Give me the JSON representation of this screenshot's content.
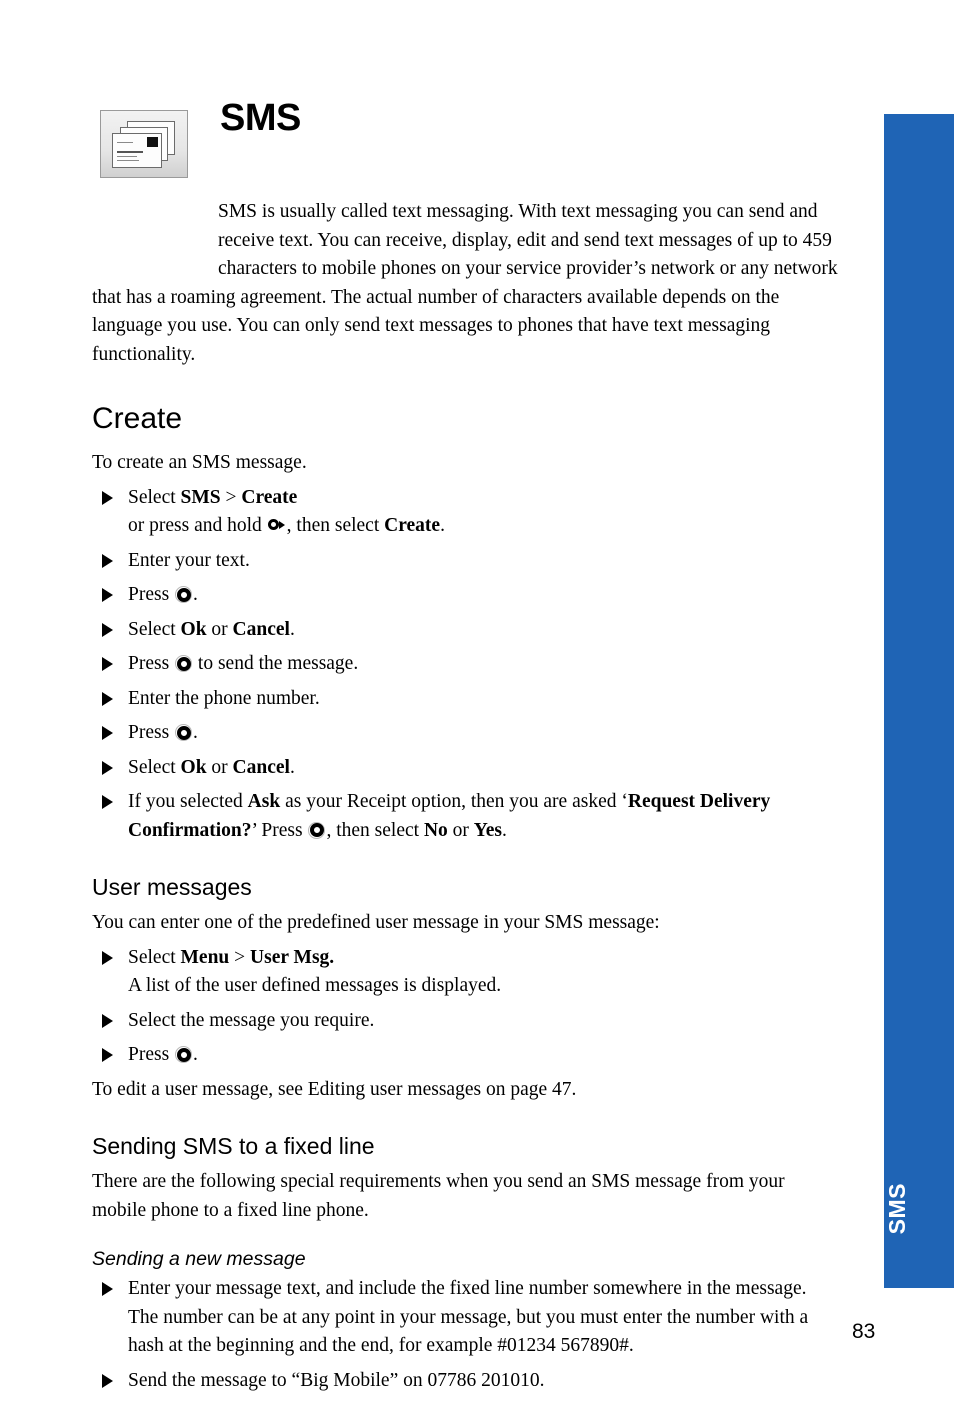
{
  "document": {
    "page_number": "83",
    "side_tab_label": "SMS",
    "side_tab_color": "#1f64b5",
    "icon_name": "sms-messages-icon"
  },
  "header": {
    "title": "SMS",
    "intro": "SMS is usually called text messaging. With text messaging you can send and receive text. You can receive, display, edit and send text messages of up to 459 characters to mobile phones on your service provider’s network or any network that has a roaming agreement. The actual number of characters available depends on the language you use. You can only send text messages to phones that have text messaging functionality."
  },
  "sections": {
    "create": {
      "heading": "Create",
      "intro": "To create an SMS message.",
      "steps": [
        {
          "parts": [
            {
              "t": "text",
              "v": "Select "
            },
            {
              "t": "bold",
              "v": "SMS"
            },
            {
              "t": "text",
              "v": " > "
            },
            {
              "t": "bold",
              "v": "Create"
            }
          ],
          "sub_parts": [
            {
              "t": "text",
              "v": "or press and hold "
            },
            {
              "t": "key",
              "v": "right-key-icon"
            },
            {
              "t": "text",
              "v": ", then select "
            },
            {
              "t": "bold",
              "v": "Create"
            },
            {
              "t": "text",
              "v": "."
            }
          ]
        },
        {
          "parts": [
            {
              "t": "text",
              "v": "Enter your text."
            }
          ]
        },
        {
          "parts": [
            {
              "t": "text",
              "v": "Press "
            },
            {
              "t": "key",
              "v": "select-key-icon"
            },
            {
              "t": "text",
              "v": "."
            }
          ]
        },
        {
          "parts": [
            {
              "t": "text",
              "v": "Select "
            },
            {
              "t": "bold",
              "v": "Ok"
            },
            {
              "t": "text",
              "v": " or "
            },
            {
              "t": "bold",
              "v": "Cancel"
            },
            {
              "t": "text",
              "v": "."
            }
          ]
        },
        {
          "parts": [
            {
              "t": "text",
              "v": "Press "
            },
            {
              "t": "key",
              "v": "select-key-icon"
            },
            {
              "t": "text",
              "v": " to send the message."
            }
          ]
        },
        {
          "parts": [
            {
              "t": "text",
              "v": "Enter the phone number."
            }
          ]
        },
        {
          "parts": [
            {
              "t": "text",
              "v": "Press "
            },
            {
              "t": "key",
              "v": "select-key-icon"
            },
            {
              "t": "text",
              "v": "."
            }
          ]
        },
        {
          "parts": [
            {
              "t": "text",
              "v": "Select "
            },
            {
              "t": "bold",
              "v": "Ok"
            },
            {
              "t": "text",
              "v": " or "
            },
            {
              "t": "bold",
              "v": "Cancel"
            },
            {
              "t": "text",
              "v": "."
            }
          ]
        },
        {
          "parts": [
            {
              "t": "text",
              "v": "If you selected "
            },
            {
              "t": "bold",
              "v": "Ask"
            },
            {
              "t": "text",
              "v": " as your Receipt option, then you are asked ‘"
            },
            {
              "t": "bold",
              "v": "Request Delivery Confirmation?"
            },
            {
              "t": "text",
              "v": "’ Press "
            },
            {
              "t": "key",
              "v": "select-key-icon"
            },
            {
              "t": "text",
              "v": ", then select "
            },
            {
              "t": "bold",
              "v": "No"
            },
            {
              "t": "text",
              "v": " or "
            },
            {
              "t": "bold",
              "v": "Yes"
            },
            {
              "t": "text",
              "v": "."
            }
          ]
        }
      ]
    },
    "user_messages": {
      "heading": "User messages",
      "intro": "You can enter one of the predefined user message in your SMS message:",
      "steps": [
        {
          "parts": [
            {
              "t": "text",
              "v": "Select "
            },
            {
              "t": "bold",
              "v": "Menu"
            },
            {
              "t": "text",
              "v": " > "
            },
            {
              "t": "bold",
              "v": "User Msg."
            }
          ],
          "sub_parts": [
            {
              "t": "text",
              "v": "A list of the user defined messages is displayed."
            }
          ]
        },
        {
          "parts": [
            {
              "t": "text",
              "v": "Select the message you require."
            }
          ]
        },
        {
          "parts": [
            {
              "t": "text",
              "v": "Press "
            },
            {
              "t": "key",
              "v": "select-key-icon"
            },
            {
              "t": "text",
              "v": "."
            }
          ]
        }
      ],
      "outro": "To edit a user message, see Editing user messages on page 47."
    },
    "fixed_line": {
      "heading": "Sending SMS to a fixed line",
      "intro": "There are the following special requirements when you send an SMS message from your mobile phone to a fixed line phone.",
      "subheading": "Sending a new message",
      "steps": [
        {
          "parts": [
            {
              "t": "text",
              "v": "Enter your message text, and include the fixed line number somewhere in the message. The number can be at any point in your message, but you must enter the number with a hash at the beginning and the end, for example #01234 567890#."
            }
          ]
        },
        {
          "parts": [
            {
              "t": "text",
              "v": "Send the message to “Big Mobile” on 07786 201010."
            }
          ]
        }
      ]
    }
  }
}
